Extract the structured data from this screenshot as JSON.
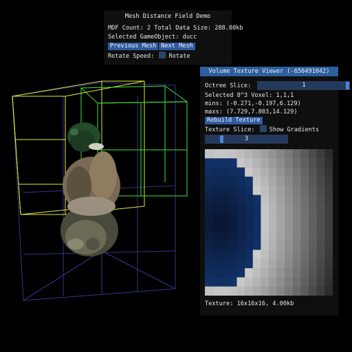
{
  "mdf_panel": {
    "title": "Mesh Distance Field Demo",
    "mdf_count_line": "MDF Count: 2 Total Data Size: 288.00kb",
    "selected_line": "Selected GameObject: ducc",
    "prev_label": "Previous Mesh",
    "next_label": "Next Mesh",
    "rotate_speed_label": "Rotate Speed:",
    "rotate_label": "Rotate"
  },
  "vtv_panel": {
    "title": "Volume Texture Viewer (-650491042)",
    "octree_label": "Octree Slice:",
    "octree_value": "1",
    "voxel_line": "Selected 8^3 Voxel: 1,1,1",
    "mins_line": "mins: (-0.271,-0.197,6.129)",
    "maxs_line": "maxs: (7.729,7.803,14.129)",
    "rebuild_label": "Rebuild Texture",
    "texture_slice_label": "Texture Slice:",
    "show_gradients_label": "Show Gradients",
    "texture_slice_value": "3",
    "footer": "Texture: 16x16x16, 4.00kb"
  },
  "colors": {
    "panel_title_bar": "#2d5e9e",
    "button": "#2f5aa0",
    "box_yellow": "#e8e83a",
    "box_green": "#3ee83e",
    "box_blue": "#34348c"
  }
}
